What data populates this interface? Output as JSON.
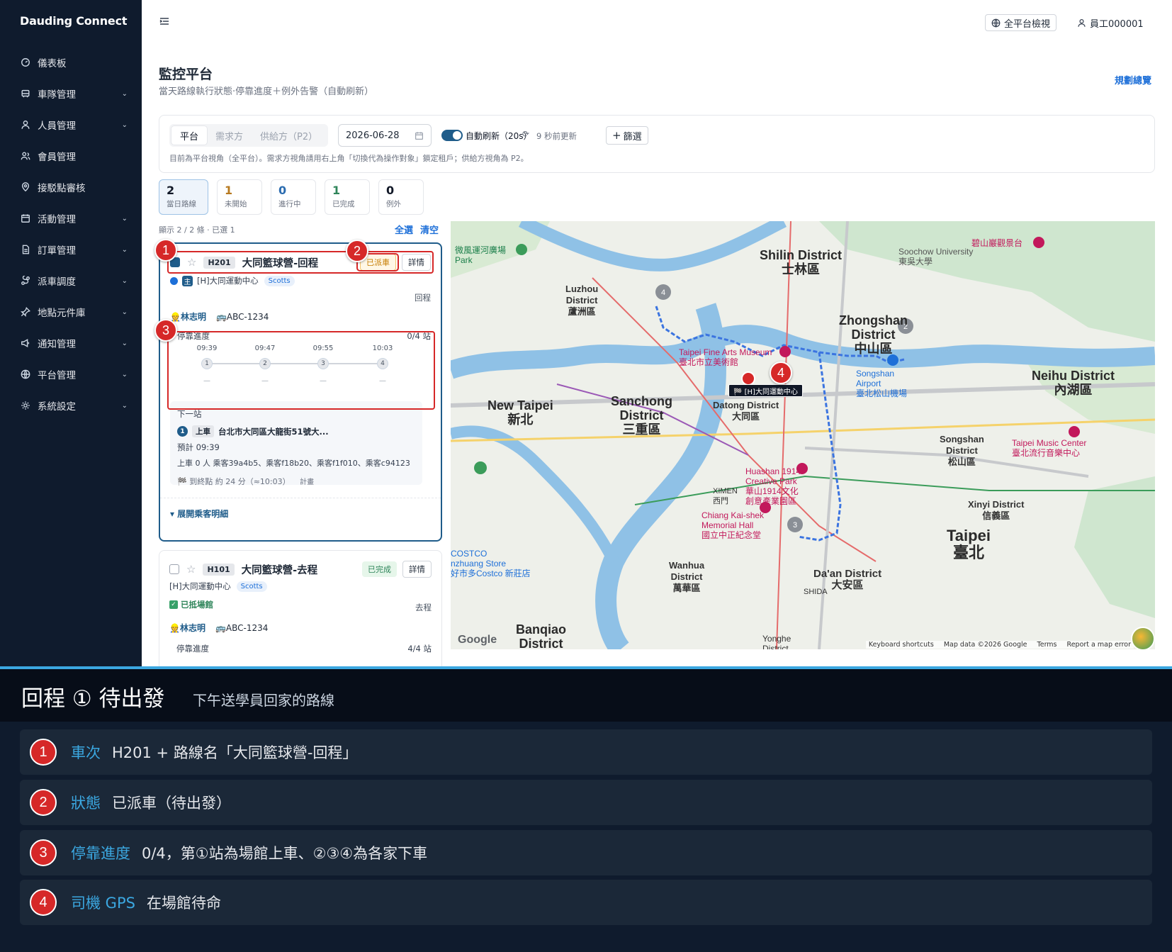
{
  "app": {
    "brand": "Dauding Connect"
  },
  "sidebar": {
    "items": [
      {
        "label": "儀表板",
        "icon": "dashboard-icon",
        "chevron": false
      },
      {
        "label": "車隊管理",
        "icon": "bus-icon",
        "chevron": true
      },
      {
        "label": "人員管理",
        "icon": "user-icon",
        "chevron": true
      },
      {
        "label": "會員管理",
        "icon": "members-icon",
        "chevron": false
      },
      {
        "label": "接駁點審核",
        "icon": "location-pin-icon",
        "chevron": false
      },
      {
        "label": "活動管理",
        "icon": "calendar-icon",
        "chevron": true
      },
      {
        "label": "訂單管理",
        "icon": "document-icon",
        "chevron": true
      },
      {
        "label": "派車調度",
        "icon": "route-icon",
        "chevron": true
      },
      {
        "label": "地點元件庫",
        "icon": "pin-icon",
        "chevron": true
      },
      {
        "label": "通知管理",
        "icon": "megaphone-icon",
        "chevron": true
      },
      {
        "label": "平台管理",
        "icon": "globe-icon",
        "chevron": true
      },
      {
        "label": "系統設定",
        "icon": "gear-icon",
        "chevron": true
      }
    ],
    "chevron_glyph": "⌄"
  },
  "topbar": {
    "view_label": "全平台檢視",
    "user_label": "員工000001"
  },
  "page": {
    "title": "監控平台",
    "subtitle": "當天路線執行狀態·停靠進度＋例外告警（自動刷新）",
    "plan_link": "規劃總覽"
  },
  "filters": {
    "segments": [
      "平台",
      "需求方",
      "供給方（P2）"
    ],
    "active_segment": 0,
    "date": "2026-06-28",
    "auto_refresh_label": "自動刷新（20s）",
    "refresh_icon": "⟳",
    "last_update": "9 秒前更新",
    "filter_plus": "+",
    "filter_label": "篩選",
    "note": "目前為平台視角（全平台）。需求方視角請用右上角「切換代為操作對象」鎖定租戶；供給方視角為 P2。"
  },
  "stats": [
    {
      "num": "2",
      "cap": "當日路線",
      "color": "dark"
    },
    {
      "num": "1",
      "cap": "未開始",
      "color": "gold"
    },
    {
      "num": "0",
      "cap": "進行中",
      "color": "blue"
    },
    {
      "num": "1",
      "cap": "已完成",
      "color": "green"
    },
    {
      "num": "0",
      "cap": "例外",
      "color": "dark"
    }
  ],
  "list": {
    "meta": "顯示 2 / 2 條 · 已選 1",
    "select_all": "全選",
    "clear": "清空"
  },
  "route1": {
    "star": "☆",
    "code": "H201",
    "name": "大同籃球營-回程",
    "status": "已派車",
    "detail": "詳情",
    "venue_tag": "主",
    "venue": "[H]大同運動中心",
    "venue_badge": "Scotts",
    "trip_type": "回程",
    "driver_icon": "👷",
    "driver": "林志明",
    "plate_icon": "🚌",
    "plate": "ABC-1234",
    "progress_label": "停靠進度",
    "progress_count": "0/4 站",
    "stops": [
      {
        "time": "09:39",
        "n": "1",
        "dash": "—"
      },
      {
        "time": "09:47",
        "n": "2",
        "dash": "—"
      },
      {
        "time": "09:55",
        "n": "3",
        "dash": "—"
      },
      {
        "time": "10:03",
        "n": "4",
        "dash": "—"
      }
    ],
    "next": {
      "title": "下一站",
      "n": "1",
      "tag": "上車",
      "address": "台北市大同區大龍街51號大...",
      "eta": "預計 09:39",
      "pax": "上車 0 人 乘客39a4b5、乘客f18b20、乘客f1f010、乘客c94123",
      "flag_icon": "🏁",
      "to_end": "到終點 約 24 分（≈10:03）",
      "calc": "計畫"
    },
    "expand": "▾ 展開乘客明細"
  },
  "route2": {
    "star": "☆",
    "code": "H101",
    "name": "大同籃球營-去程",
    "status": "已完成",
    "detail": "詳情",
    "venue": "[H]大同運動中心",
    "venue_badge": "Scotts",
    "arrived_check": "✓",
    "arrived": "已抵場館",
    "trip_type": "去程",
    "driver_icon": "👷",
    "driver": "林志明",
    "plate_icon": "🚌",
    "plate": "ABC-1234",
    "progress_label": "停靠進度",
    "progress_count": "4/4 站"
  },
  "markers": [
    "1",
    "2",
    "3",
    "4"
  ],
  "map": {
    "labels": {
      "shilin": "Shilin District\n士林區",
      "zhongshan": "Zhongshan\nDistrict\n中山區",
      "neihu": "Neihu District\n內湖區",
      "new_taipei": "New Taipei\n新北",
      "sanchong": "Sanchong\nDistrict\n三重區",
      "datong": "Datong District\n大同區",
      "taipei": "Taipei\n臺北",
      "daan": "Da'an District\n大安區",
      "songshan": "Songshan\nDistrict\n松山區",
      "xinyi": "Xinyi District\n信義區",
      "wanhua": "Wanhua\nDistrict\n萬華區",
      "banqiao": "Banqiao\nDistrict",
      "luzhou": "Luzhou\nDistrict\n蘆洲區",
      "fine_arts": "Taipei Fine Arts Museum\n臺北市立美術館",
      "songshan_airport": "Songshan\nAirport\n臺北松山機場",
      "huashan": "Huashan 1914\nCreative Park\n華山1914文化\n創意產業園區",
      "chiang": "Chiang Kai-shek\nMemorial Hall\n國立中正紀念堂",
      "soochow": "Soochow University\n東吳大學",
      "music_center": "Taipei Music Center\n臺北流行音樂中心",
      "bishan": "碧山巖觀景台",
      "costco": "COSTCO\nnzhuang Store\n好市多Costco 新莊店",
      "ximen": "XIMEN\n西門",
      "shida": "SHIDA",
      "yonghe": "Yonghe\nDistrict",
      "riverside": "微風運河廣場\nPark"
    },
    "vehicle_label": "🏁 [H]大同運動中心",
    "google": "Google",
    "footer": [
      "Keyboard shortcuts",
      "Map data ©2026 Google",
      "Terms",
      "Report a map error"
    ]
  },
  "explain": {
    "title": "回程 ① 待出發",
    "subtitle": "下午送學員回家的路線",
    "rows": [
      {
        "n": "1",
        "key": "車次",
        "val": "H201 + 路線名「大同籃球營-回程」"
      },
      {
        "n": "2",
        "key": "狀態",
        "val": "已派車（待出發）"
      },
      {
        "n": "3",
        "key": "停靠進度",
        "val": "0/4，第①站為場館上車、②③④為各家下車"
      },
      {
        "n": "4",
        "key": "司機 GPS",
        "val": "在場館待命"
      }
    ]
  },
  "colors": {
    "accent": "#1f5c8a",
    "highlight": "#d62828",
    "link": "#1d6fd8",
    "explain_key": "#3ba7e0"
  }
}
